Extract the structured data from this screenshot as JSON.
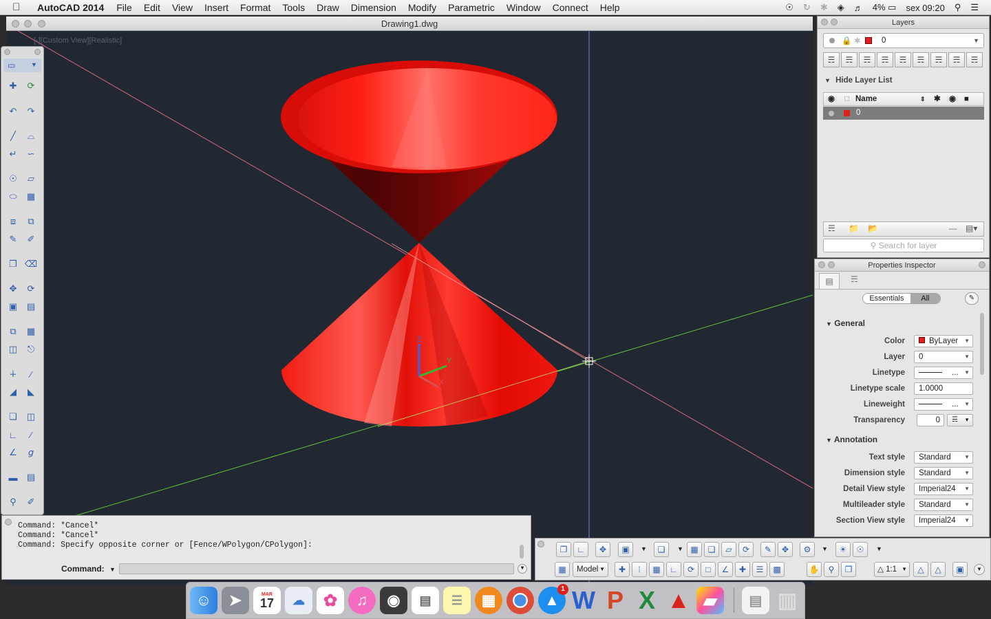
{
  "menubar": {
    "app_name": "AutoCAD 2014",
    "items": [
      "File",
      "Edit",
      "View",
      "Insert",
      "Format",
      "Tools",
      "Draw",
      "Dimension",
      "Modify",
      "Parametric",
      "Window",
      "Connect",
      "Help"
    ],
    "battery": "4%",
    "clock": "sex 09:20"
  },
  "drawing": {
    "title": "Drawing1.dwg",
    "view_label": "[-][Custom View][Realistic]",
    "ucs": {
      "z": "Z",
      "y": "Y",
      "x": "X"
    }
  },
  "command": {
    "lines": [
      "Command: *Cancel*",
      "Command: *Cancel*",
      "Command: Specify opposite corner or [Fence/WPolygon/CPolygon]:"
    ],
    "label": "Command:"
  },
  "status": {
    "model_label": "Model",
    "scale_label": "1:1"
  },
  "layers": {
    "title": "Layers",
    "current_layer": "0",
    "hide_list_label": "Hide Layer List",
    "column_name": "Name",
    "rows": [
      {
        "name": "0"
      }
    ],
    "search_placeholder": "Search for layer",
    "layer_color": "#e0201c"
  },
  "properties": {
    "title": "Properties Inspector",
    "tab_essentials": "Essentials",
    "tab_all": "All",
    "general_label": "General",
    "general": [
      {
        "label": "Color",
        "value": "ByLayer"
      },
      {
        "label": "Layer",
        "value": "0"
      },
      {
        "label": "Linetype",
        "value": "..."
      },
      {
        "label": "Linetype scale",
        "value": "1.0000"
      },
      {
        "label": "Lineweight",
        "value": "..."
      },
      {
        "label": "Transparency",
        "value": "0"
      }
    ],
    "annotation_label": "Annotation",
    "annotation": [
      {
        "label": "Text style",
        "value": "Standard"
      },
      {
        "label": "Dimension style",
        "value": "Standard"
      },
      {
        "label": "Detail View style",
        "value": "Imperial24"
      },
      {
        "label": "Multileader style",
        "value": "Standard"
      },
      {
        "label": "Section View style",
        "value": "Imperial24"
      }
    ]
  },
  "dock": {
    "calendar_month": "MAR",
    "calendar_day": "17",
    "appstore_badge": "1",
    "word_letter": "W",
    "powerpoint_letter": "P",
    "excel_letter": "X"
  },
  "colors": {
    "viewport_bg": "#222831",
    "cone_red": "#e8100e",
    "axis_red": "#d96b78",
    "axis_green": "#63c13a",
    "axis_blue": "#7d7df0"
  }
}
